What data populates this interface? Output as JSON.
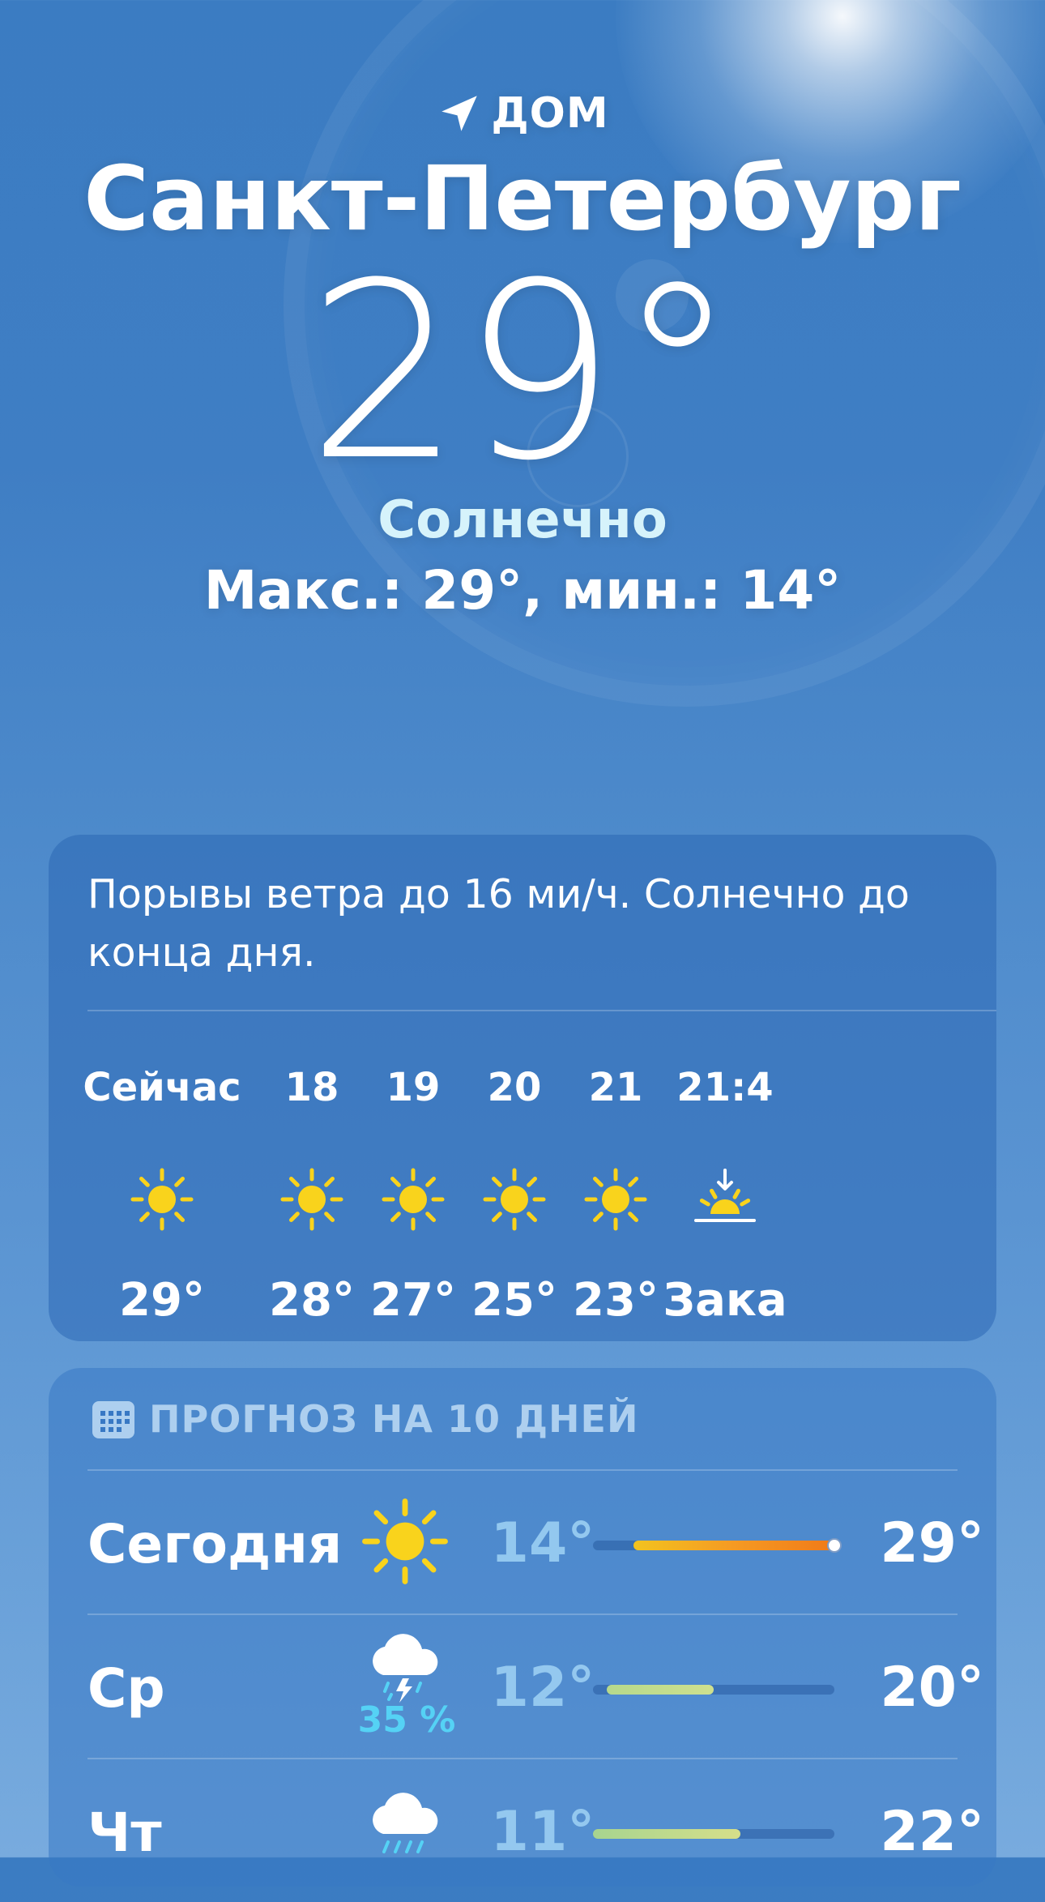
{
  "location": {
    "label": "ДОМ",
    "icon": "location-arrow-icon"
  },
  "city": "Санкт-Петербург",
  "current": {
    "temperature": "29°",
    "condition": "Солнечно",
    "high_low": "Макс.: 29°, мин.: 14°"
  },
  "hourly": {
    "summary": "Порывы ветра до 16 ми/ч. Солнечно до конца дня.",
    "items": [
      {
        "time": "Сейчас",
        "icon": "sun-icon",
        "temp": "29°"
      },
      {
        "time": "18",
        "icon": "sun-icon",
        "temp": "28°"
      },
      {
        "time": "19",
        "icon": "sun-icon",
        "temp": "27°"
      },
      {
        "time": "20",
        "icon": "sun-icon",
        "temp": "25°"
      },
      {
        "time": "21",
        "icon": "sun-icon",
        "temp": "23°"
      },
      {
        "time": "21:4",
        "icon": "sunset-icon",
        "temp": "Зака"
      }
    ]
  },
  "forecast": {
    "title": "ПРОГНОЗ НА 10 ДНЕЙ",
    "icon": "calendar-icon",
    "range": [
      11,
      29
    ],
    "days": [
      {
        "day": "Сегодня",
        "icon": "sun-icon",
        "precip": "",
        "low": "14°",
        "high": "29°",
        "low_value": 14,
        "high_value": 29,
        "current_value": 29,
        "bar_colors": [
          "#f2c31f",
          "#f59a23",
          "#f07a18"
        ]
      },
      {
        "day": "Ср",
        "icon": "thunderstorm-icon",
        "precip": "35 %",
        "low": "12°",
        "high": "20°",
        "low_value": 12,
        "high_value": 20,
        "bar_colors": [
          "#b6d98c",
          "#cfe08e"
        ]
      },
      {
        "day": "Чт",
        "icon": "rain-icon",
        "precip": "",
        "low": "11°",
        "high": "22°",
        "low_value": 11,
        "high_value": 22,
        "bar_colors": [
          "#a7d48f",
          "#d6df8a"
        ]
      }
    ]
  },
  "colors": {
    "accent_condition": "#d6f3fb",
    "sun": "#f9d31c",
    "precip": "#55d2f5"
  }
}
